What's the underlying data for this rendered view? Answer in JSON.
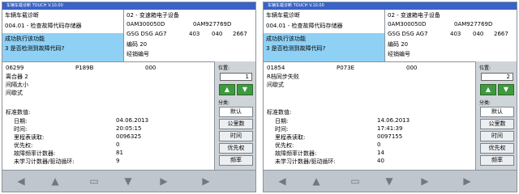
{
  "panels": [
    {
      "window_title": "车辆车载诊断   TOUCH   V.10.00",
      "header_left": [
        "车辆车载诊断",
        "004.01 - 检查故障代码存储器",
        "成功执行该功能",
        "3 是否检测到故障代码?"
      ],
      "header_right": {
        "system": "02 - 变速箱电子设备",
        "part_left": "0AM300050D",
        "part_right": "0AM927769D",
        "gearbox": "GSG DSG AG7",
        "n1": "403",
        "n2": "040",
        "n3": "2667",
        "code": "编码 20",
        "dealer": "经销编号"
      },
      "dtc": {
        "code": "06299",
        "pcode": "P189B",
        "status": "000"
      },
      "desc": [
        "离合器 2",
        "间隔太小",
        "间歇式"
      ],
      "std_title": "标准数值:",
      "rows": [
        {
          "label": "日期:",
          "value": "04.06.2013"
        },
        {
          "label": "时间:",
          "value": "20:05:15"
        },
        {
          "label": "里程表读取:",
          "value": "0096325"
        },
        {
          "label": "优先权:",
          "value": "0"
        },
        {
          "label": "故障频率计数器:",
          "value": "81"
        },
        {
          "label": "未学习计数器/驱动循环:",
          "value": "9"
        }
      ],
      "side": {
        "position_label": "位置:",
        "position_value": "1",
        "category_label": "分类:",
        "buttons": [
          "默认",
          "公里数",
          "时间",
          "优先权",
          "频率"
        ]
      }
    },
    {
      "window_title": "车辆车载诊断   TOUCH   V.10.00",
      "header_left": [
        "车辆车载诊断",
        "004.01 - 检查故障代码存储器",
        "成功执行该功能",
        "3 是否检测到故障代码?"
      ],
      "header_right": {
        "system": "02 - 变速箱电子设备",
        "part_left": "0AM300050D",
        "part_right": "0AM927769D",
        "gearbox": "GSG DSG AG7",
        "n1": "403",
        "n2": "040",
        "n3": "2667",
        "code": "编码 20",
        "dealer": "经销编号"
      },
      "dtc": {
        "code": "01854",
        "pcode": "P073E",
        "status": "000"
      },
      "desc": [
        "R档同步失败",
        "间歇式"
      ],
      "std_title": "标准数值:",
      "rows": [
        {
          "label": "日期:",
          "value": "14.06.2013"
        },
        {
          "label": "时间:",
          "value": "17:41:39"
        },
        {
          "label": "里程表读取:",
          "value": "0097155"
        },
        {
          "label": "优先权:",
          "value": "0"
        },
        {
          "label": "故障频率计数器:",
          "value": "14"
        },
        {
          "label": "未学习计数器/驱动循环:",
          "value": "40"
        }
      ],
      "side": {
        "position_label": "位置:",
        "position_value": "2",
        "category_label": "分类:",
        "buttons": [
          "默认",
          "公里数",
          "时间",
          "优先权",
          "频率"
        ]
      }
    }
  ]
}
